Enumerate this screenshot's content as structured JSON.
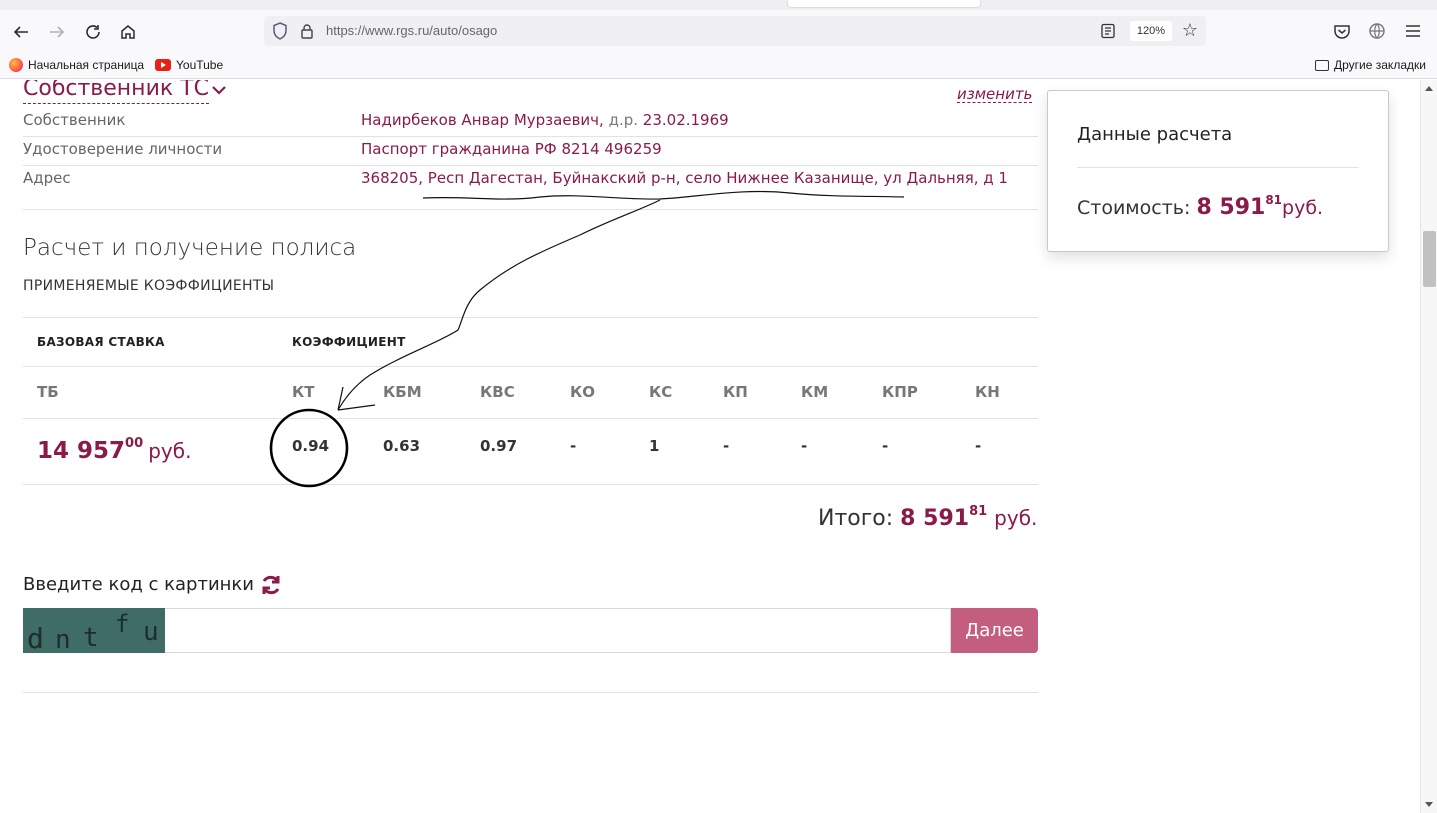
{
  "browser": {
    "url": "https://www.rgs.ru/auto/osago",
    "zoom": "120%",
    "bookmarks": [
      {
        "label": "Начальная страница",
        "icon": "firefox-icon"
      },
      {
        "label": "YouTube",
        "icon": "youtube-icon"
      }
    ],
    "other_bookmarks": "Другие закладки"
  },
  "owner_section": {
    "title": "Собственник ТС",
    "edit_label": "изменить",
    "rows": [
      {
        "label": "Собственник",
        "value": "Надирбеков Анвар Мурзаевич,",
        "dob_prefix": "д.р.",
        "dob": "23.02.1969"
      },
      {
        "label": "Удостоверение личности",
        "value": "Паспорт гражданина РФ 8214 496259"
      },
      {
        "label": "Адрес",
        "value": "368205, Респ Дагестан, Буйнакский р-н, село Нижнее Казанище, ул Дальняя, д 1"
      }
    ]
  },
  "calc_section": {
    "title": "Расчет и получение полиса",
    "coefficients_heading": "ПРИМЕНЯЕМЫЕ КОЭФФИЦИЕНТЫ",
    "base_rate_header": "БАЗОВАЯ СТАВКА",
    "coefficient_header": "КОЭФФИЦИЕНТ",
    "columns": [
      "ТБ",
      "КТ",
      "КБМ",
      "КВС",
      "КО",
      "КС",
      "КП",
      "КМ",
      "КПР",
      "КН"
    ],
    "base_rate": {
      "int": "14 957",
      "frac": "00",
      "currency": "руб."
    },
    "values": [
      "0.94",
      "0.63",
      "0.97",
      "-",
      "1",
      "-",
      "-",
      "-",
      "-"
    ],
    "total_label": "Итого:",
    "total": {
      "int": "8 591",
      "frac": "81",
      "currency": "руб."
    }
  },
  "captcha": {
    "title": "Введите код с картинки",
    "image_text": "dntfu",
    "input_value": "",
    "next_label": "Далее"
  },
  "summary_card": {
    "title": "Данные расчета",
    "cost_label": "Стоимость:",
    "cost": {
      "int": "8 591",
      "frac": "81",
      "currency": "руб."
    }
  },
  "colors": {
    "accent": "#8a1a4a",
    "button": "#c45e7f"
  }
}
